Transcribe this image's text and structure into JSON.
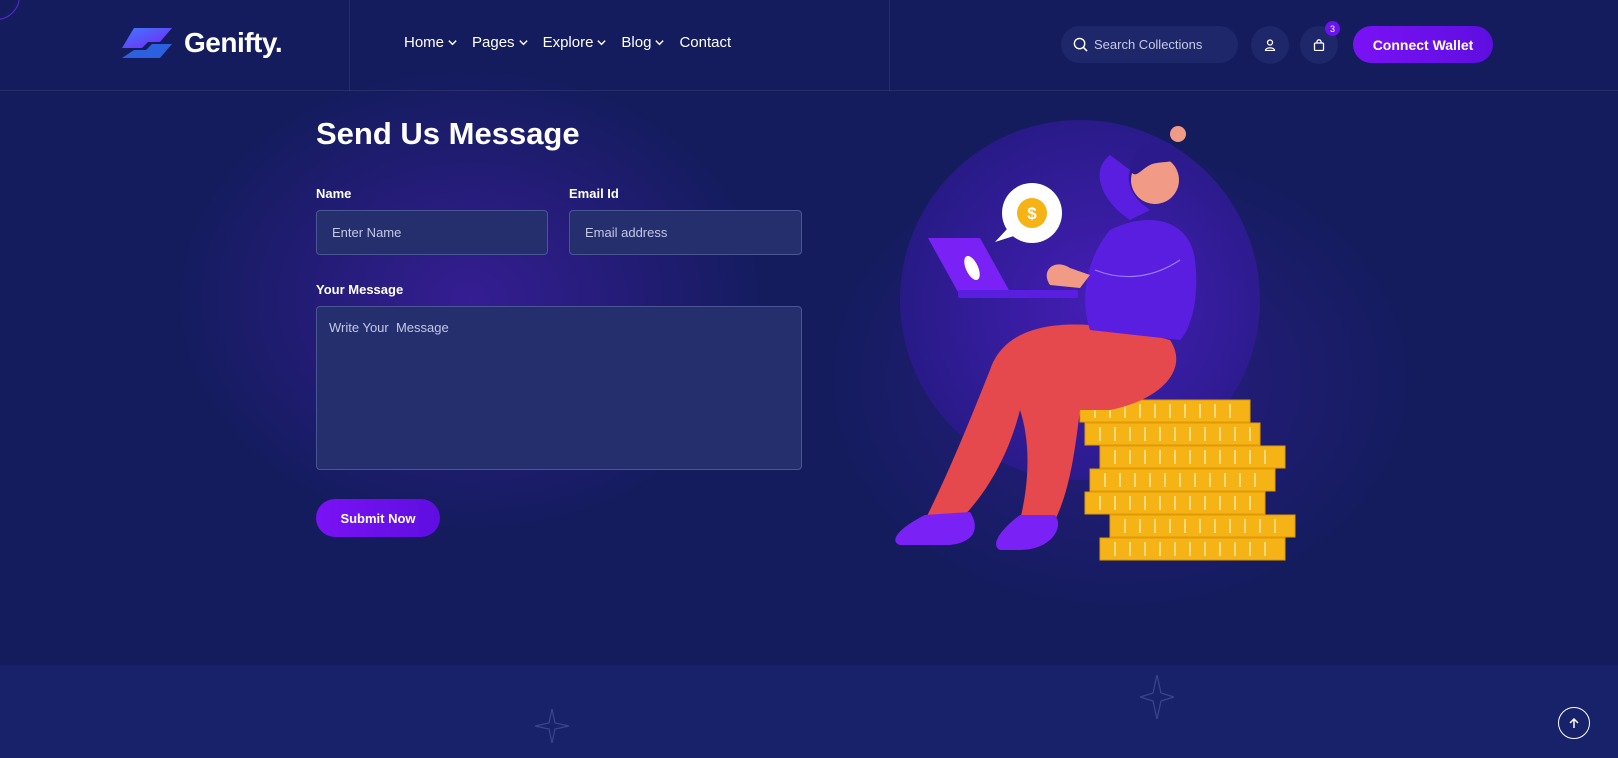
{
  "brand": {
    "name": "Genifty."
  },
  "nav": {
    "items": [
      {
        "label": "Home",
        "has_dropdown": true
      },
      {
        "label": "Pages",
        "has_dropdown": true
      },
      {
        "label": "Explore",
        "has_dropdown": true
      },
      {
        "label": "Blog",
        "has_dropdown": true
      },
      {
        "label": "Contact",
        "has_dropdown": false
      }
    ]
  },
  "search": {
    "placeholder": "Search Collections",
    "icon": "search-icon"
  },
  "header_actions": {
    "user_icon": "user-icon",
    "cart_icon": "bag-icon",
    "cart_count": "3",
    "connect_label": "Connect Wallet"
  },
  "form": {
    "title": "Send Us Message",
    "name_label": "Name",
    "name_placeholder": "Enter Name",
    "email_label": "Email Id",
    "email_placeholder": "Email address",
    "message_label": "Your Message",
    "message_placeholder": "Write Your  Message",
    "submit_label": "Submit Now"
  },
  "colors": {
    "background": "#141c5e",
    "accent": "#6a12f0",
    "field_bg": "#252f6d",
    "coin": "#f5b316"
  },
  "scroll_top_icon": "arrow-up-icon"
}
